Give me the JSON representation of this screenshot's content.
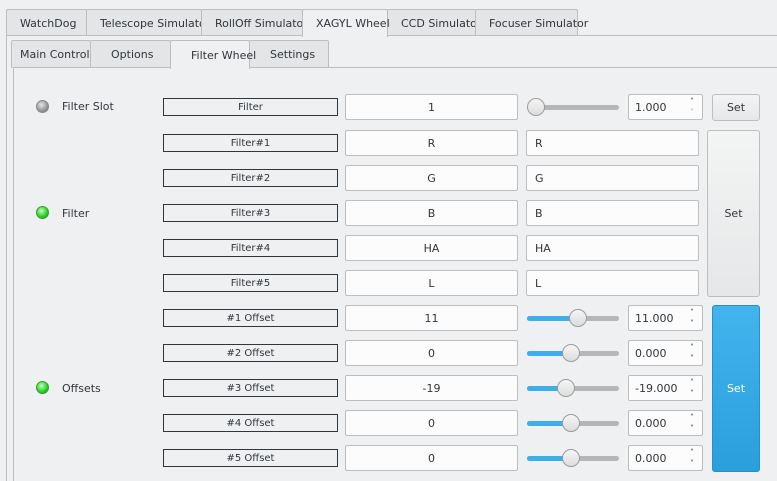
{
  "tabs": [
    "WatchDog",
    "Telescope Simulator",
    "RollOff Simulator",
    "XAGYL Wheel",
    "CCD Simulator",
    "Focuser Simulator"
  ],
  "active_tab": "XAGYL Wheel",
  "subtabs": [
    "Main Control",
    "Options",
    "Filter Wheel",
    "Settings"
  ],
  "active_subtab": "Filter Wheel",
  "filter_slot": {
    "label": "Filter Slot",
    "status": "idle",
    "element_name": "Filter",
    "value": "1",
    "slider_fraction": 0.0,
    "spin_value": "1.000",
    "set_label": "Set"
  },
  "filter": {
    "label": "Filter",
    "status": "ok",
    "rows": [
      {
        "name": "Filter#1",
        "value": "R",
        "input": "R"
      },
      {
        "name": "Filter#2",
        "value": "G",
        "input": "G"
      },
      {
        "name": "Filter#3",
        "value": "B",
        "input": "B"
      },
      {
        "name": "Filter#4",
        "value": "HA",
        "input": "HA"
      },
      {
        "name": "Filter#5",
        "value": "L",
        "input": "L"
      }
    ],
    "set_label": "Set"
  },
  "offsets": {
    "label": "Offsets",
    "status": "ok",
    "rows": [
      {
        "name": "#1 Offset",
        "value": "11",
        "spin": "11.000",
        "slider_fraction": 0.57
      },
      {
        "name": "#2 Offset",
        "value": "0",
        "spin": "0.000",
        "slider_fraction": 0.48
      },
      {
        "name": "#3 Offset",
        "value": "-19",
        "spin": "-19.000",
        "slider_fraction": 0.42
      },
      {
        "name": "#4 Offset",
        "value": "0",
        "spin": "0.000",
        "slider_fraction": 0.48
      },
      {
        "name": "#5 Offset",
        "value": "0",
        "spin": "0.000",
        "slider_fraction": 0.48
      }
    ],
    "set_label": "Set"
  },
  "colors": {
    "accent": "#3daee9",
    "led_ok": "#2fd62a",
    "led_idle": "#9a9a9a"
  }
}
